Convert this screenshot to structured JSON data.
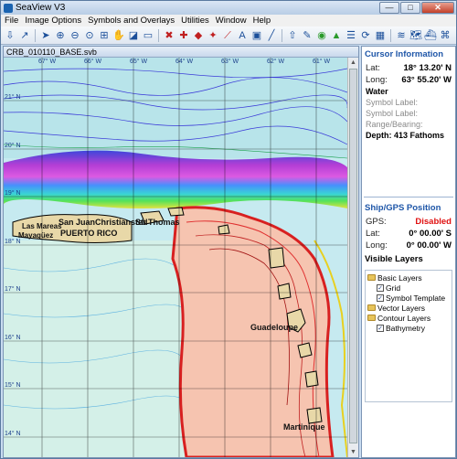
{
  "window": {
    "title": "SeaView V3",
    "min": "—",
    "max": "□",
    "close": "✕"
  },
  "menu": [
    "File",
    "Image Options",
    "Symbols and Overlays",
    "Utilities",
    "Window",
    "Help"
  ],
  "map": {
    "doc_title": "CRB_010110_BASE.svb",
    "lon_labels": [
      "67° W",
      "66° W",
      "65° W",
      "64° W",
      "63° W",
      "62° W",
      "61° W"
    ],
    "lat_labels": [
      "21° N",
      "20° N",
      "19° N",
      "18° N",
      "17° N",
      "16° N",
      "15° N",
      "14° N"
    ],
    "places": [
      "San Juan",
      "Christiansted",
      "St. Thomas",
      "PUERTO RICO",
      "Guadeloupe",
      "Martinique",
      "Las Mareas",
      "Mayagüez"
    ]
  },
  "cursor": {
    "heading": "Cursor Information",
    "lat_label": "Lat:",
    "lat": "18° 13.20' N",
    "long_label": "Long:",
    "long": "63° 55.20' W",
    "water": "Water",
    "symbol1": "Symbol Label:",
    "symbol2": "Symbol Label:",
    "range": "Range/Bearing:",
    "depth": "Depth: 413 Fathoms"
  },
  "gps": {
    "heading": "Ship/GPS Position",
    "gps_label": "GPS:",
    "gps_status": "Disabled",
    "lat_label": "Lat:",
    "lat": "0° 00.00' S",
    "long_label": "Long:",
    "long": "0° 00.00' W"
  },
  "layers": {
    "heading": "Visible Layers",
    "basic": "Basic Layers",
    "grid": "Grid",
    "symbol_template": "Symbol Template",
    "vector": "Vector Layers",
    "contour": "Contour Layers",
    "bathymetry": "Bathymetry"
  },
  "colors": {
    "heading": "#1e56a8",
    "disabled": "#e01010"
  }
}
